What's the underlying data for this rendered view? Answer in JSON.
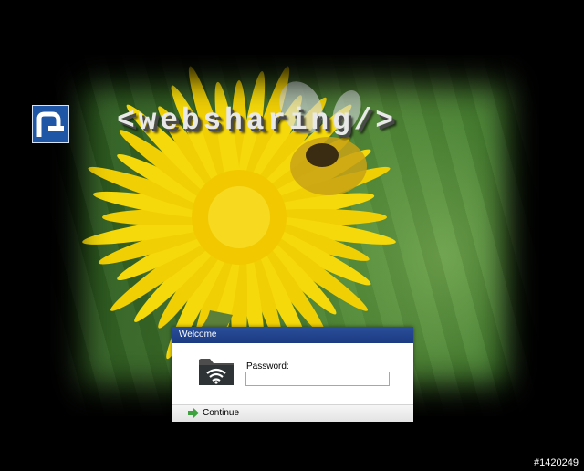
{
  "brand": {
    "logo_glyph": "n",
    "title": "<websharing/>"
  },
  "login_dialog": {
    "title": "Welcome",
    "password_label": "Password:",
    "password_value": "",
    "continue_label": "Continue"
  },
  "image_id_label": "#1420249",
  "colors": {
    "dialog_header": "#1f3f8a",
    "logo_bg": "#1f56a6",
    "input_border": "#c8a84a",
    "continue_arrow": "#3ea33e",
    "flower_yellow": "#f5d90a"
  },
  "icons": [
    "websharing-logo-icon",
    "shared-folder-icon",
    "continue-arrow-icon"
  ]
}
